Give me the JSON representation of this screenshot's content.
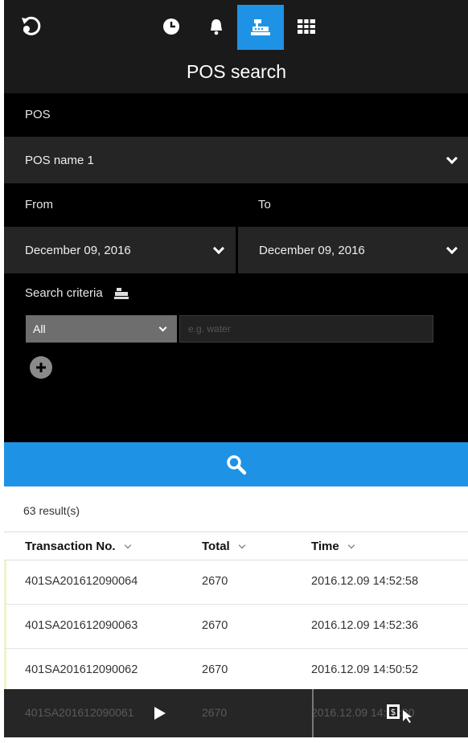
{
  "header": {
    "title": "POS search",
    "icons": [
      "back-icon",
      "clock-icon",
      "bell-icon",
      "pos-register-icon",
      "grid-icon"
    ],
    "active_tab": "pos-register-icon",
    "accent_color": "#1e93e6"
  },
  "form": {
    "pos_label": "POS",
    "pos_value": "POS name 1",
    "from_label": "From",
    "to_label": "To",
    "from_value": "December 09, 2016",
    "to_value": "December 09, 2016",
    "criteria_label": "Search criteria",
    "criteria_select": "All",
    "criteria_placeholder": "e.g. water"
  },
  "results": {
    "count": "63 result(s)",
    "columns": [
      "Transaction No.",
      "Total",
      "Time"
    ],
    "rows": [
      [
        "401SA201612090064",
        "2670",
        "2016.12.09 14:52:58"
      ],
      [
        "401SA201612090063",
        "2670",
        "2016.12.09 14:52:36"
      ],
      [
        "401SA201612090062",
        "2670",
        "2016.12.09 14:50:52"
      ],
      [
        "401SA201612090061",
        "2670",
        "2016.12.09 14:50:30"
      ]
    ]
  }
}
